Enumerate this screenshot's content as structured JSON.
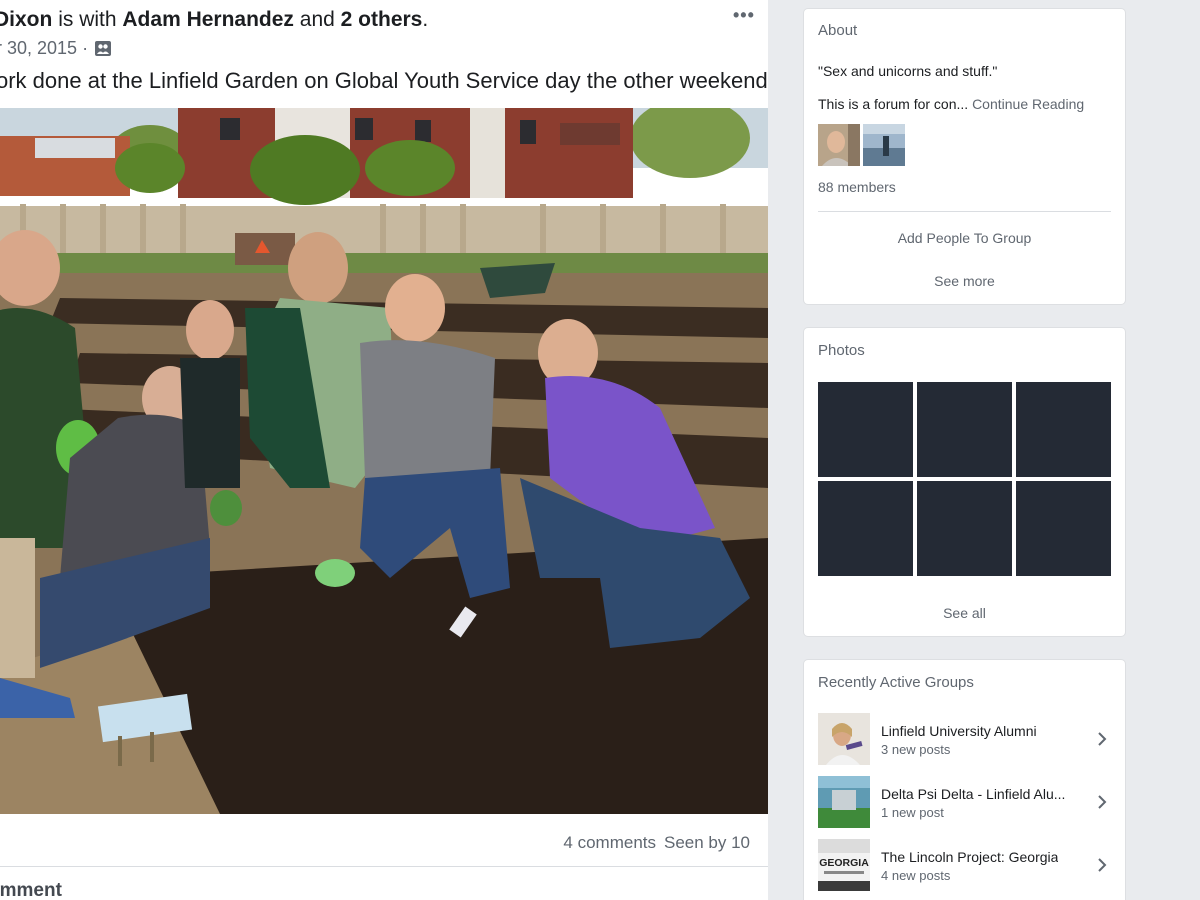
{
  "post": {
    "author": "Dixon",
    "with_text": "is with",
    "tagged_person": "Adam Hernandez",
    "and_text": "and",
    "others": "2 others",
    "period": ".",
    "date": "r 30, 2015 ·",
    "caption": "ork done at the Linfield Garden on Global Youth Service day the other weekend.",
    "more_icon": "more-horizontal-icon",
    "comments": "4 comments",
    "seen_by": "Seen by 10",
    "comment_action": "omment"
  },
  "about": {
    "title": "About",
    "quote": "\"Sex and unicorns and stuff.\"",
    "description": "This is a forum for con...",
    "continue_reading": "Continue Reading",
    "members": "88 members",
    "add_people": "Add People To Group",
    "see_more": "See more"
  },
  "photos": {
    "title": "Photos",
    "see_all": "See all",
    "tile_color": "#242a35"
  },
  "recent_groups": {
    "title": "Recently Active Groups",
    "items": [
      {
        "name": "Linfield University Alumni",
        "posts": "3 new posts"
      },
      {
        "name": "Delta Psi Delta - Linfield Alu...",
        "posts": "1 new post"
      },
      {
        "name": "The Lincoln Project: Georgia",
        "posts": "4 new posts",
        "thumb_text": "GEORGIA"
      }
    ]
  },
  "colors": {
    "background": "#e9ebee",
    "card": "#ffffff",
    "secondary_text": "#606770",
    "primary_text": "#1c1e21"
  }
}
